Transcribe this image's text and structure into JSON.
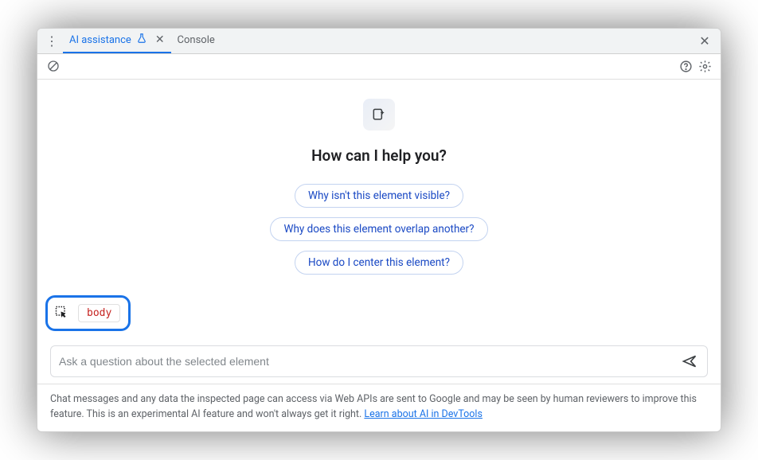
{
  "tabs": {
    "ai": "AI assistance",
    "console": "Console"
  },
  "main": {
    "heading": "How can I help you?",
    "suggestions": [
      "Why isn't this element visible?",
      "Why does this element overlap another?",
      "How do I center this element?"
    ]
  },
  "selector": {
    "element": "body"
  },
  "input": {
    "placeholder": "Ask a question about the selected element"
  },
  "footer": {
    "text": "Chat messages and any data the inspected page can access via Web APIs are sent to Google and may be seen by human reviewers to improve this feature. This is an experimental AI feature and won't always get it right. ",
    "link": "Learn about AI in DevTools"
  }
}
